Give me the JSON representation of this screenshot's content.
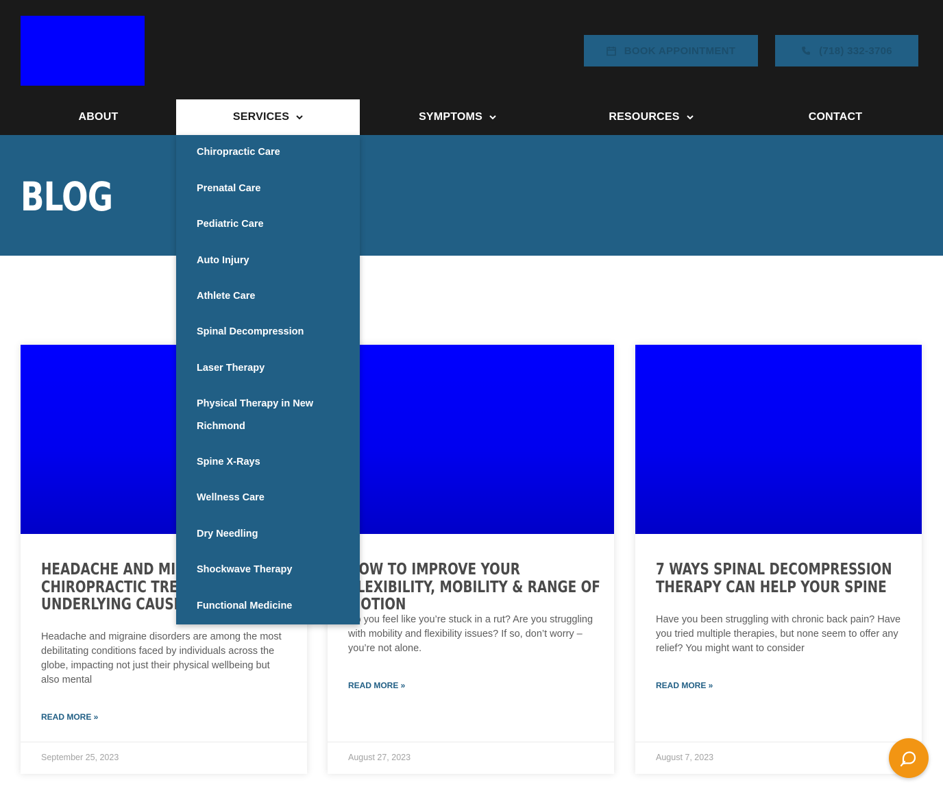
{
  "header": {
    "book_label": "BOOK APPOINTMENT",
    "phone_label": "(718) 332-3706",
    "book_icon": "calendar-icon",
    "phone_icon": "phone-icon"
  },
  "nav": {
    "items": [
      {
        "label": "ABOUT",
        "has_dropdown": false
      },
      {
        "label": "SERVICES",
        "has_dropdown": true
      },
      {
        "label": "SYMPTOMS",
        "has_dropdown": true
      },
      {
        "label": "RESOURCES",
        "has_dropdown": true
      },
      {
        "label": "CONTACT",
        "has_dropdown": false
      }
    ]
  },
  "dropdown": {
    "items": [
      "Chiropractic Care",
      "Prenatal Care",
      "Pediatric Care",
      "Auto Injury",
      "Athlete Care",
      "Spinal Decompression",
      "Laser Therapy",
      "Physical Therapy in New Richmond",
      "Spine X-Rays",
      "Wellness Care",
      "Dry Needling",
      "Shockwave Therapy",
      "Functional Medicine"
    ]
  },
  "hero": {
    "title": "BLOG"
  },
  "posts": [
    {
      "title": "HEADACHE AND MIGRAINE CHIROPRACTIC TREATMENT: UNDERLYING CAUSES",
      "excerpt": "Headache and migraine disorders are among the most debilitating conditions faced by individuals across the globe, impacting not just their physical wellbeing but also mental",
      "read_more": "READ MORE »",
      "date": "September 25, 2023"
    },
    {
      "title": "HOW TO IMPROVE YOUR FLEXIBILITY, MOBILITY & RANGE OF MOTION",
      "excerpt": "Do you feel like you’re stuck in a rut? Are you struggling with mobility and flexibility issues? If so, don’t worry – you’re not alone.",
      "read_more": "READ MORE »",
      "date": "August 27, 2023"
    },
    {
      "title": "7 WAYS SPINAL DECOMPRESSION THERAPY CAN HELP YOUR SPINE",
      "excerpt": "Have you been struggling with chronic back pain? Have you tried multiple therapies, but none seem to offer any relief? You might want to consider",
      "read_more": "READ MORE »",
      "date": "August 7, 2023"
    }
  ],
  "colors": {
    "header_bg": "#1a1a1a",
    "accent": "#215f85",
    "logo_placeholder": "#0000ff",
    "chat_button": "#f29513"
  },
  "chat": {
    "icon": "chat-bubble-icon"
  }
}
